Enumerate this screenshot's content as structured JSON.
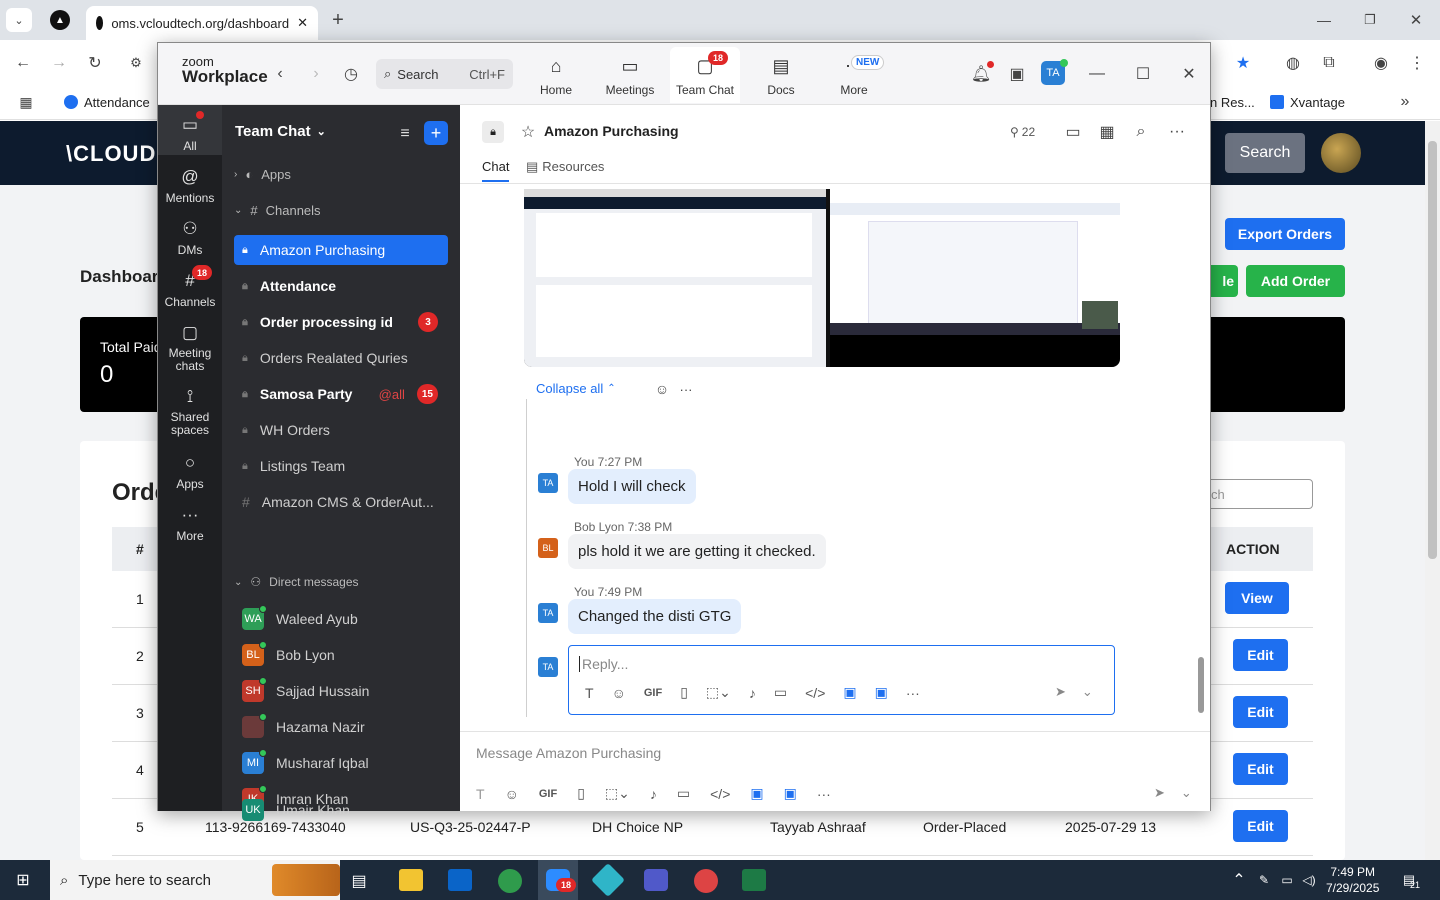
{
  "browser": {
    "tab_title": "oms.vcloudtech.org/dashboard",
    "bookmarks": {
      "left": "Attendance",
      "right1": "n Res...",
      "right2": "Xvantage"
    }
  },
  "site": {
    "logo": "\\CLOUDC",
    "search_btn": "Search",
    "heading": "Dashboard",
    "total_paid_label": "Total Paid",
    "total_paid_value": "0",
    "export_btn": "Export Orders",
    "le_btn": "le",
    "add_order_btn": "Add Order",
    "orders_heading": "Orde",
    "search_placeholder": "ch",
    "table": {
      "col_num": "#",
      "col_action": "ACTION",
      "rows": [
        {
          "n": "1",
          "action": "View"
        },
        {
          "n": "2",
          "action": "Edit"
        },
        {
          "n": "3",
          "action": "Edit"
        },
        {
          "n": "4",
          "action": "Edit"
        },
        {
          "n": "5",
          "action": "Edit",
          "order": "113-9266169-7433040",
          "po": "US-Q3-25-02447-P",
          "store": "DH Choice NP",
          "user": "Tayyab Ashraaf",
          "status": "Order-Placed",
          "date": "2025-07-29 13"
        }
      ]
    }
  },
  "zoom": {
    "brand_top": "zoom",
    "brand_bottom": "Workplace",
    "search_label": "Search",
    "search_shortcut": "Ctrl+F",
    "nav": [
      {
        "label": "Home",
        "icon": "home-icon"
      },
      {
        "label": "Meetings",
        "icon": "video-icon"
      },
      {
        "label": "Team Chat",
        "icon": "chat-icon",
        "badge": "18"
      },
      {
        "label": "Docs",
        "icon": "doc-icon"
      },
      {
        "label": "More",
        "icon": "more-icon",
        "badge": "NEW"
      }
    ],
    "avatar_initials": "TA",
    "rail": [
      {
        "label": "All"
      },
      {
        "label": "Mentions"
      },
      {
        "label": "DMs"
      },
      {
        "label": "Channels",
        "badge": "18"
      },
      {
        "label": "Meeting chats"
      },
      {
        "label": "Shared spaces"
      },
      {
        "label": "Apps"
      },
      {
        "label": "More"
      }
    ],
    "panel": {
      "title": "Team Chat",
      "apps_label": "Apps",
      "channels_label": "Channels",
      "channels": [
        {
          "name": "Amazon Purchasing",
          "active": true
        },
        {
          "name": "Attendance",
          "bold": true
        },
        {
          "name": "Order processing id",
          "bold": true,
          "badge": "3"
        },
        {
          "name": "Orders Realated Quries"
        },
        {
          "name": "Samosa Party",
          "bold": true,
          "mention": "@all",
          "badge": "15"
        },
        {
          "name": "WH Orders"
        },
        {
          "name": "Listings Team"
        },
        {
          "name": "Amazon CMS & OrderAut..."
        }
      ],
      "dm_label": "Direct messages",
      "dms": [
        {
          "initials": "WA",
          "name": "Waleed Ayub",
          "color": "#2e9e57"
        },
        {
          "initials": "BL",
          "name": "Bob Lyon",
          "color": "#d4611a"
        },
        {
          "initials": "SH",
          "name": "Sajjad Hussain",
          "color": "#c0392b"
        },
        {
          "initials": "",
          "name": "Hazama Nazir",
          "color": "#6b3a3a"
        },
        {
          "initials": "MI",
          "name": "Musharaf Iqbal",
          "color": "#2a7fd4"
        },
        {
          "initials": "IK",
          "name": "Imran Khan",
          "color": "#c0392b"
        },
        {
          "initials": "UK",
          "name": "Umair Khan",
          "color": "#178c73"
        }
      ]
    },
    "channel": {
      "title": "Amazon Purchasing",
      "members": "22",
      "tab_chat": "Chat",
      "tab_resources": "Resources",
      "collapse_label": "Collapse all"
    },
    "messages": [
      {
        "initials": "TA",
        "sender": "You",
        "time": "7:27 PM",
        "text": "Hold I will check",
        "color": "#2a7fd4"
      },
      {
        "initials": "BL",
        "sender": "Bob Lyon",
        "time": "7:38 PM",
        "text": "pls hold it we are getting it checked.",
        "color": "#d4611a"
      },
      {
        "initials": "TA",
        "sender": "You",
        "time": "7:49 PM",
        "text": "Changed the disti GTG",
        "color": "#2a7fd4"
      }
    ],
    "reply_placeholder": "Reply...",
    "message_placeholder": "Message Amazon Purchasing"
  },
  "taskbar": {
    "search_placeholder": "Type here to search",
    "time": "7:49 PM",
    "date": "7/29/2025",
    "zoom_badge": "18",
    "notif": "21"
  }
}
